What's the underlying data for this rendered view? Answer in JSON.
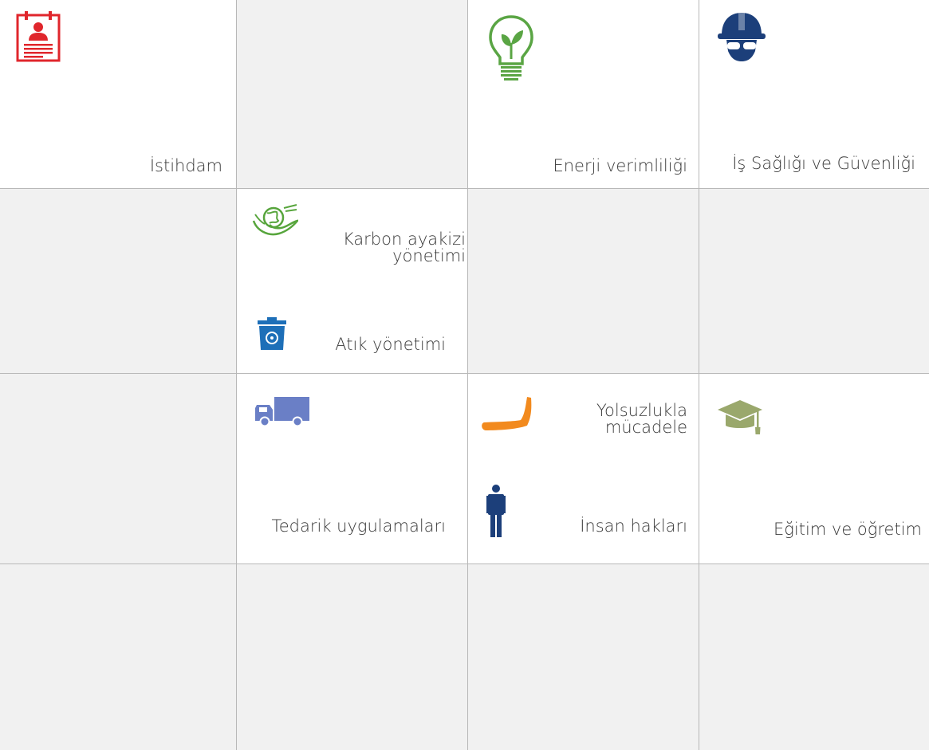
{
  "topics": [
    {
      "key": "employment",
      "label": "İstihdam",
      "icon": "id-card-icon",
      "color": "#e0262c"
    },
    {
      "key": "energy",
      "label": "Enerji verimliliği",
      "icon": "light-bulb-icon",
      "color": "#5aa544"
    },
    {
      "key": "safety",
      "label": "İş Sağlığı ve Güvenliği",
      "icon": "hard-hat-icon",
      "color": "#1c3f7a"
    },
    {
      "key": "carbon",
      "label_lines": [
        "Karbon ayakizi",
        "yönetimi"
      ],
      "icon": "hand-globe-icon",
      "color": "#57a53c"
    },
    {
      "key": "waste",
      "label": "Atık yönetimi",
      "icon": "recycle-bin-icon",
      "color": "#1d6fb8"
    },
    {
      "key": "supply",
      "label": "Tedarik uygulamaları",
      "icon": "truck-icon",
      "color": "#6a7fc6"
    },
    {
      "key": "corruption",
      "label_lines": [
        "Yolsuzlukla",
        "mücadele"
      ],
      "icon": "arm-stop-icon",
      "color": "#f28a1e"
    },
    {
      "key": "education",
      "label": "Eğitim ve öğretim",
      "icon": "graduation-cap-icon",
      "color": "#9aa86c"
    },
    {
      "key": "rights",
      "label": "İnsan hakları",
      "icon": "person-icon",
      "color": "#1c3f7a"
    }
  ]
}
